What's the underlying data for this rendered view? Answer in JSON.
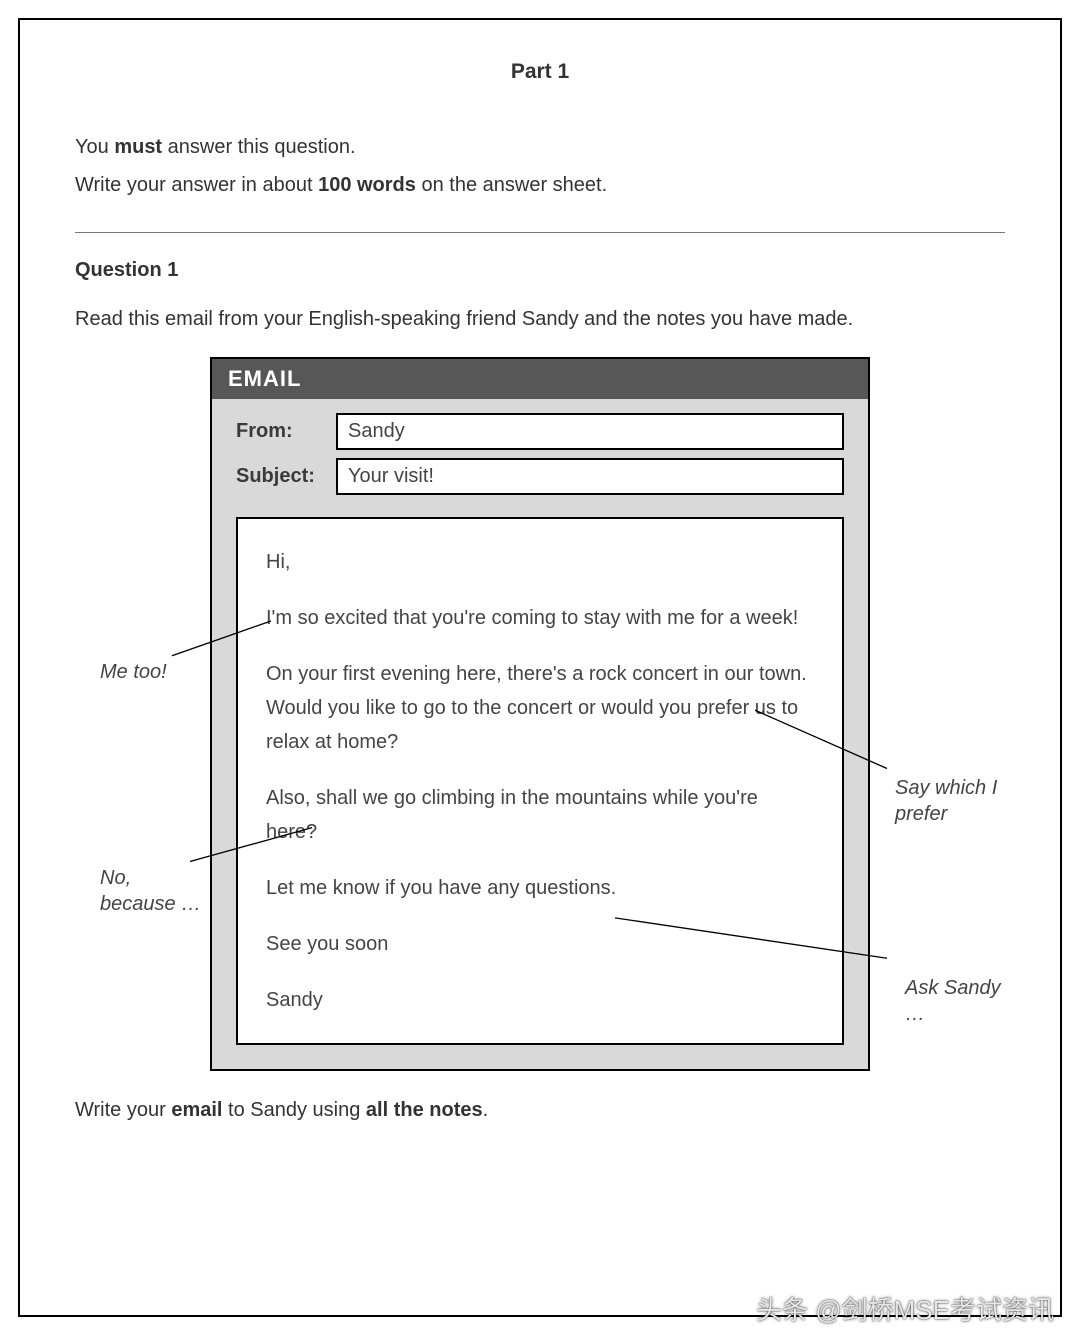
{
  "part_title": "Part 1",
  "instruction_line1_pre": "You ",
  "instruction_line1_bold": "must",
  "instruction_line1_post": " answer this question.",
  "instruction_line2_pre": "Write your answer in about ",
  "instruction_line2_bold": "100 words",
  "instruction_line2_post": " on the answer sheet.",
  "question_heading": "Question 1",
  "prompt": "Read this email from your English-speaking friend Sandy and the notes you have made.",
  "email": {
    "header": "EMAIL",
    "from_label": "From:",
    "from_value": "Sandy",
    "subject_label": "Subject:",
    "subject_value": "Your visit!",
    "body": {
      "greeting": "Hi,",
      "p1": "I'm so excited that you're coming to stay with me for a week!",
      "p2": "On your first evening here, there's a rock concert in our town. Would you like to go to the concert or would you prefer us to relax at home?",
      "p3": "Also, shall we go climbing in the mountains while you're here?",
      "p4": "Let me know if you have any questions.",
      "signoff": "See you soon",
      "signature": "Sandy"
    }
  },
  "notes": {
    "n1": "Me too!",
    "n2": "Say which I prefer",
    "n3": "No, because …",
    "n4": "Ask Sandy …"
  },
  "closing_pre": "Write your ",
  "closing_b1": "email",
  "closing_mid": " to Sandy using ",
  "closing_b2": "all the notes",
  "closing_post": ".",
  "watermark": "头条 @剑桥MSE考试资讯"
}
